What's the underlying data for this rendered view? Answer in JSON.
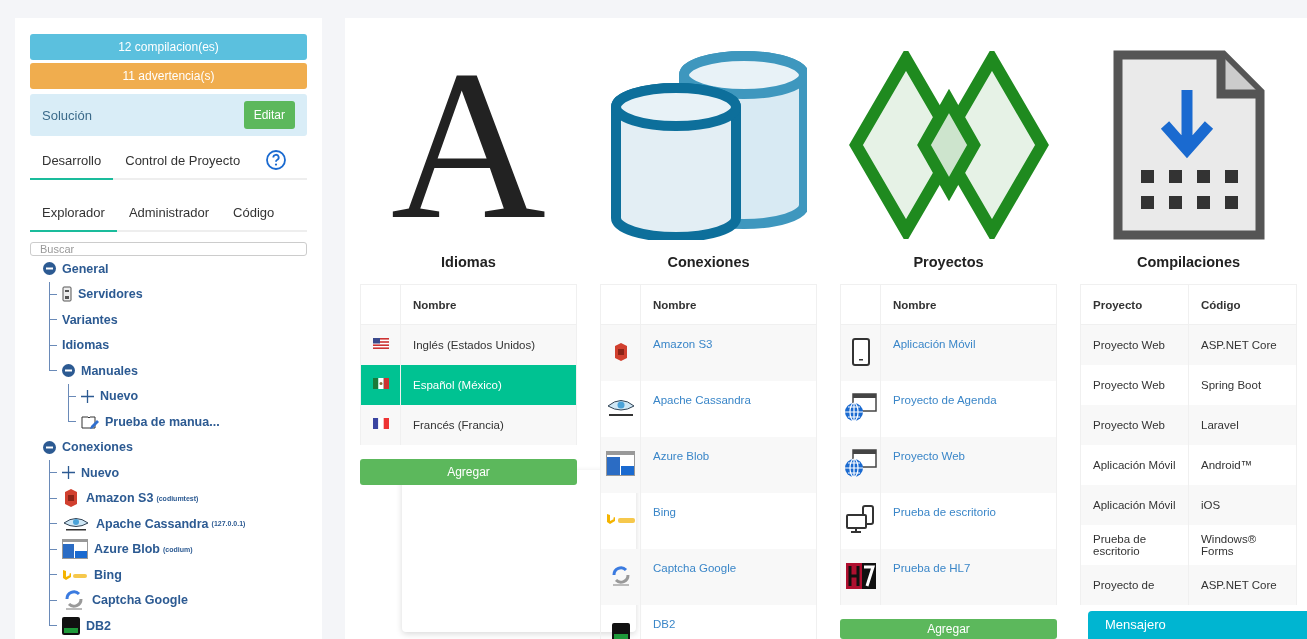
{
  "sidebar": {
    "badges": [
      {
        "label": "12 compilacion(es)",
        "kind": "info"
      },
      {
        "label": "11 advertencia(s)",
        "kind": "warning"
      }
    ],
    "solution": {
      "label": "Solución",
      "button": "Editar"
    },
    "tabs": [
      {
        "label": "Desarrollo",
        "selected": true
      },
      {
        "label": "Control de Proyecto",
        "selected": false
      }
    ],
    "subtabs": [
      {
        "label": "Explorador",
        "selected": true
      },
      {
        "label": "Administrador",
        "selected": false
      },
      {
        "label": "Código",
        "selected": false
      }
    ],
    "search": {
      "placeholder": "Buscar"
    },
    "tree": [
      {
        "label": "General",
        "kind": "group",
        "expanded": true,
        "children": [
          {
            "label": "Servidores",
            "kind": "server"
          },
          {
            "label": "Variantes",
            "kind": "plain"
          },
          {
            "label": "Idiomas",
            "kind": "plain"
          },
          {
            "label": "Manuales",
            "kind": "group",
            "expanded": true,
            "children": [
              {
                "label": "Nuevo",
                "kind": "add"
              },
              {
                "label": "Prueba de manua...",
                "kind": "manual"
              }
            ]
          }
        ]
      },
      {
        "label": "Conexiones",
        "kind": "group",
        "expanded": true,
        "children": [
          {
            "label": "Nuevo",
            "kind": "add"
          },
          {
            "label": "Amazon S3",
            "kind": "s3",
            "note": "(codiumtest)"
          },
          {
            "label": "Apache Cassandra",
            "kind": "cassandra",
            "note": "(127.0.0.1)"
          },
          {
            "label": "Azure Blob",
            "kind": "azure",
            "note": "(codium)"
          },
          {
            "label": "Bing",
            "kind": "bing"
          },
          {
            "label": "Captcha Google",
            "kind": "captcha"
          },
          {
            "label": "DB2",
            "kind": "db2"
          }
        ]
      }
    ]
  },
  "sections": [
    {
      "title": "Idiomas",
      "kind": "languages",
      "glyph": "A",
      "columns": [
        "",
        "Nombre"
      ],
      "rows": [
        {
          "name": "Inglés (Estados Unidos)",
          "kind": "us",
          "selected": false
        },
        {
          "name": "Español (México)",
          "kind": "mx",
          "selected": true
        },
        {
          "name": "Francés (Francia)",
          "kind": "fr",
          "selected": false
        }
      ],
      "button": "Agregar"
    },
    {
      "title": "Conexiones",
      "kind": "connections",
      "columns": [
        "",
        "Nombre"
      ],
      "rows": [
        {
          "name": "Amazon S3",
          "kind": "s3"
        },
        {
          "name": "Apache Cassandra",
          "kind": "cassandra"
        },
        {
          "name": "Azure Blob",
          "kind": "azure"
        },
        {
          "name": "Bing",
          "kind": "bing"
        },
        {
          "name": "Captcha Google",
          "kind": "captcha"
        },
        {
          "name": "DB2",
          "kind": "db2"
        }
      ]
    },
    {
      "title": "Proyectos",
      "kind": "projects",
      "columns": [
        "",
        "Nombre"
      ],
      "rows": [
        {
          "name": "Aplicación Móvil",
          "kind": "phone"
        },
        {
          "name": "Proyecto de Agenda",
          "kind": "web"
        },
        {
          "name": "Proyecto Web",
          "kind": "web"
        },
        {
          "name": "Prueba de escritorio",
          "kind": "desktop"
        },
        {
          "name": "Prueba de HL7",
          "kind": "hl7"
        }
      ],
      "button": "Agregar"
    },
    {
      "title": "Compilaciones",
      "kind": "builds",
      "columns": [
        "Proyecto",
        "Código"
      ],
      "rows": [
        {
          "project": "Proyecto Web",
          "code": "ASP.NET Core"
        },
        {
          "project": "Proyecto Web",
          "code": "Spring Boot"
        },
        {
          "project": "Proyecto Web",
          "code": "Laravel"
        },
        {
          "project": "Aplicación Móvil",
          "code": "Android™"
        },
        {
          "project": "Aplicación Móvil",
          "code": "iOS"
        },
        {
          "project": "Prueba de escritorio",
          "code": "Windows® Forms"
        },
        {
          "project": "Proyecto de",
          "code": "ASP.NET Core"
        }
      ]
    }
  ],
  "messenger": {
    "label": "Mensajero"
  }
}
